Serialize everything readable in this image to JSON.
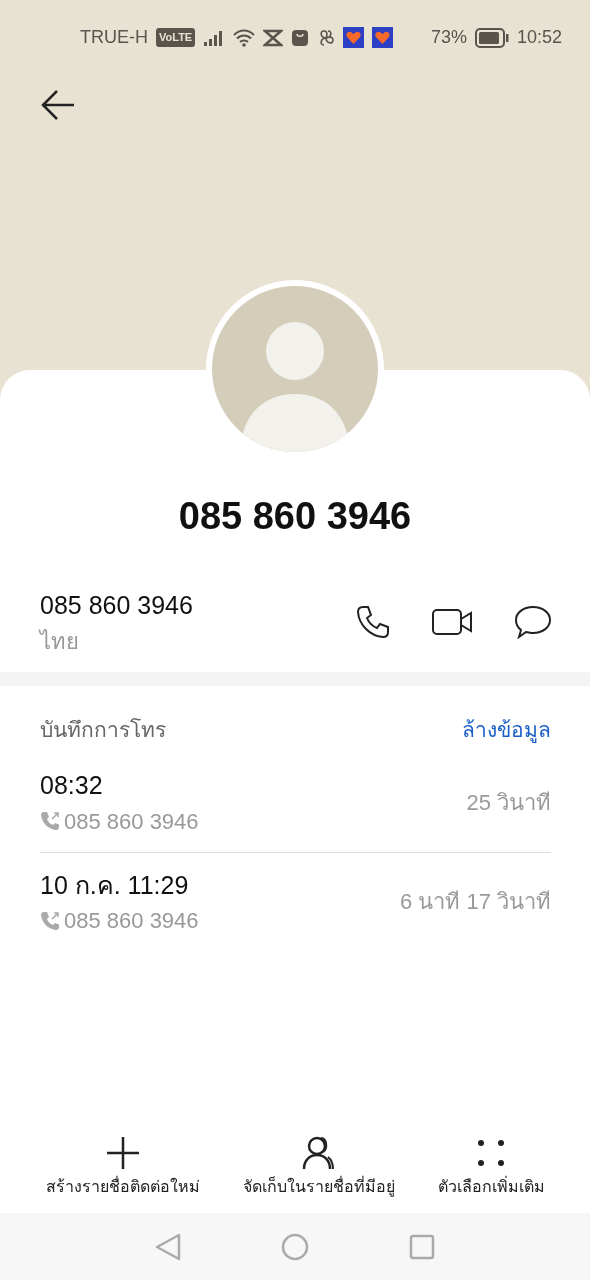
{
  "status_bar": {
    "carrier": "TRUE-H",
    "network_badge": "VoLTE",
    "battery": "73%",
    "time": "10:52"
  },
  "contact": {
    "title": "085 860 3946",
    "number": "085 860 3946",
    "region": "ไทย"
  },
  "call_log": {
    "title": "บันทึกการโทร",
    "clear_link": "ล้างข้อมูล",
    "entries": [
      {
        "time": "08:32",
        "number": "085 860 3946",
        "duration": "25 วินาที"
      },
      {
        "time": "10 ก.ค. 11:29",
        "number": "085 860 3946",
        "duration": "6 นาที 17 วินาที"
      }
    ]
  },
  "actions": [
    {
      "kind": "add",
      "label": "สร้างรายชื่อติดต่อใหม่"
    },
    {
      "kind": "person",
      "label": "จัดเก็บในรายชื่อที่มีอยู่"
    },
    {
      "kind": "more",
      "label": "ตัวเลือกเพิ่มเติม"
    }
  ]
}
